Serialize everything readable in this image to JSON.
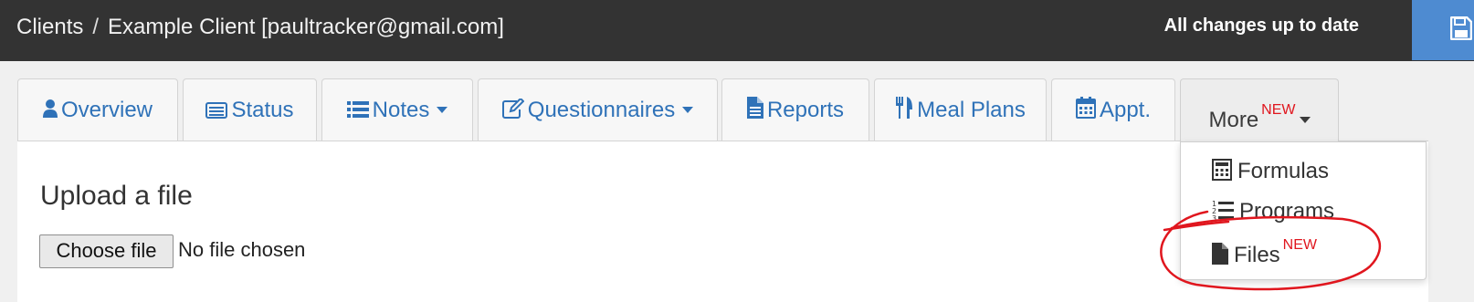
{
  "header": {
    "breadcrumb": [
      "Clients",
      "Example Client [paultracker@gmail.com]"
    ],
    "separator": "/",
    "status": "All changes up to date",
    "save_icon": "floppy-disk-icon",
    "background_color": "#333333",
    "save_color": "#4e8bd1"
  },
  "tabs": [
    {
      "label": "Overview",
      "icon": "user-icon"
    },
    {
      "label": "Status",
      "icon": "id-card-icon"
    },
    {
      "label": "Notes",
      "icon": "list-icon",
      "dropdown": true
    },
    {
      "label": "Questionnaires",
      "icon": "edit-icon",
      "dropdown": true
    },
    {
      "label": "Reports",
      "icon": "file-text-icon"
    },
    {
      "label": "Meal Plans",
      "icon": "cutlery-icon"
    },
    {
      "label": "Appt.",
      "icon": "calendar-icon"
    },
    {
      "label": "More",
      "badge": "NEW",
      "dropdown": true,
      "active": true
    }
  ],
  "main": {
    "title": "Upload a file",
    "file_button": "Choose file",
    "file_status": "No file chosen"
  },
  "more_menu": [
    {
      "label": "Formulas",
      "icon": "calculator-icon"
    },
    {
      "label": "Programs",
      "icon": "ordered-list-icon"
    },
    {
      "label": "Files",
      "icon": "file-icon",
      "badge": "NEW"
    }
  ],
  "colors": {
    "link": "#2f72b8",
    "badge": "#e0161e",
    "annotation": "#e0161e"
  }
}
